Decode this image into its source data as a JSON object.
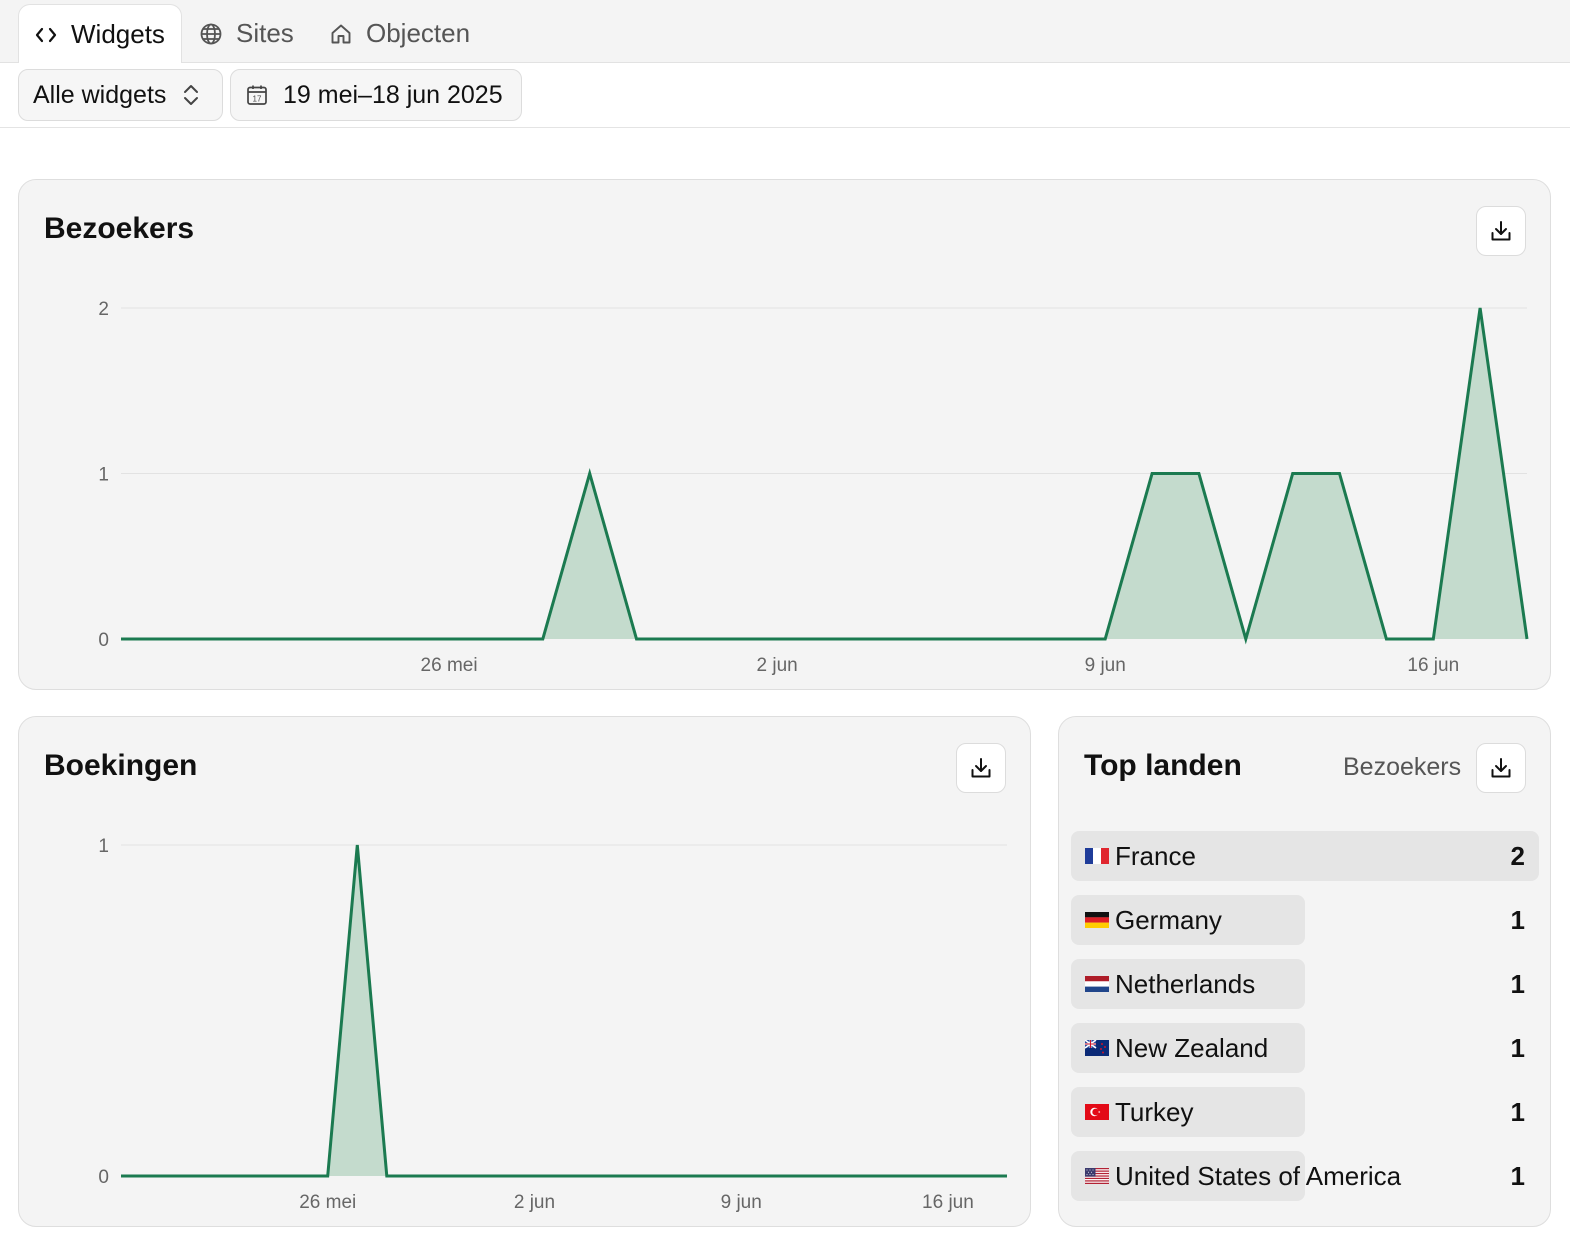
{
  "tabs": [
    {
      "label": "Widgets",
      "icon": "code-icon",
      "active": true
    },
    {
      "label": "Sites",
      "icon": "globe-icon",
      "active": false
    },
    {
      "label": "Objecten",
      "icon": "home-icon",
      "active": false
    }
  ],
  "filters": {
    "widget_select": "Alle widgets",
    "date_range": "19 mei–18 jun 2025"
  },
  "colors": {
    "line": "#1b7a50",
    "fill": "#c4dbcd"
  },
  "visitors_card": {
    "title": "Bezoekers",
    "chart_data": {
      "type": "area",
      "x": [
        "19 mei",
        "20 mei",
        "21 mei",
        "22 mei",
        "23 mei",
        "24 mei",
        "25 mei",
        "26 mei",
        "27 mei",
        "28 mei",
        "29 mei",
        "30 mei",
        "31 mei",
        "1 jun",
        "2 jun",
        "3 jun",
        "4 jun",
        "5 jun",
        "6 jun",
        "7 jun",
        "8 jun",
        "9 jun",
        "10 jun",
        "11 jun",
        "12 jun",
        "13 jun",
        "14 jun",
        "15 jun",
        "16 jun",
        "17 jun",
        "18 jun"
      ],
      "values": [
        0,
        0,
        0,
        0,
        0,
        0,
        0,
        0,
        0,
        0,
        1,
        0,
        0,
        0,
        0,
        0,
        0,
        0,
        0,
        0,
        0,
        0,
        1,
        1,
        0,
        1,
        1,
        0,
        0,
        2,
        0
      ],
      "x_ticks": [
        "26 mei",
        "2 jun",
        "9 jun",
        "16 jun"
      ],
      "y_ticks": [
        "0",
        "1",
        "2"
      ],
      "ylim": [
        0,
        2
      ],
      "grid": true
    }
  },
  "bookings_card": {
    "title": "Boekingen",
    "chart_data": {
      "type": "area",
      "x": [
        "19 mei",
        "20 mei",
        "21 mei",
        "22 mei",
        "23 mei",
        "24 mei",
        "25 mei",
        "26 mei",
        "27 mei",
        "28 mei",
        "29 mei",
        "30 mei",
        "31 mei",
        "1 jun",
        "2 jun",
        "3 jun",
        "4 jun",
        "5 jun",
        "6 jun",
        "7 jun",
        "8 jun",
        "9 jun",
        "10 jun",
        "11 jun",
        "12 jun",
        "13 jun",
        "14 jun",
        "15 jun",
        "16 jun",
        "17 jun",
        "18 jun"
      ],
      "values": [
        0,
        0,
        0,
        0,
        0,
        0,
        0,
        0,
        1,
        0,
        0,
        0,
        0,
        0,
        0,
        0,
        0,
        0,
        0,
        0,
        0,
        0,
        0,
        0,
        0,
        0,
        0,
        0,
        0,
        0,
        0
      ],
      "x_ticks": [
        "26 mei",
        "2 jun",
        "9 jun",
        "16 jun"
      ],
      "y_ticks": [
        "0",
        "1"
      ],
      "ylim": [
        0,
        1
      ],
      "grid": true
    }
  },
  "countries_card": {
    "title": "Top landen",
    "metric": "Bezoekers",
    "rows": [
      {
        "flag": "france-flag-icon",
        "name": "France",
        "count": "2",
        "share": 1.0
      },
      {
        "flag": "germany-flag-icon",
        "name": "Germany",
        "count": "1",
        "share": 0.5
      },
      {
        "flag": "netherlands-flag-icon",
        "name": "Netherlands",
        "count": "1",
        "share": 0.5
      },
      {
        "flag": "new-zealand-flag-icon",
        "name": "New Zealand",
        "count": "1",
        "share": 0.5
      },
      {
        "flag": "turkey-flag-icon",
        "name": "Turkey",
        "count": "1",
        "share": 0.5
      },
      {
        "flag": "usa-flag-icon",
        "name": "United States of America",
        "count": "1",
        "share": 0.5
      }
    ]
  }
}
